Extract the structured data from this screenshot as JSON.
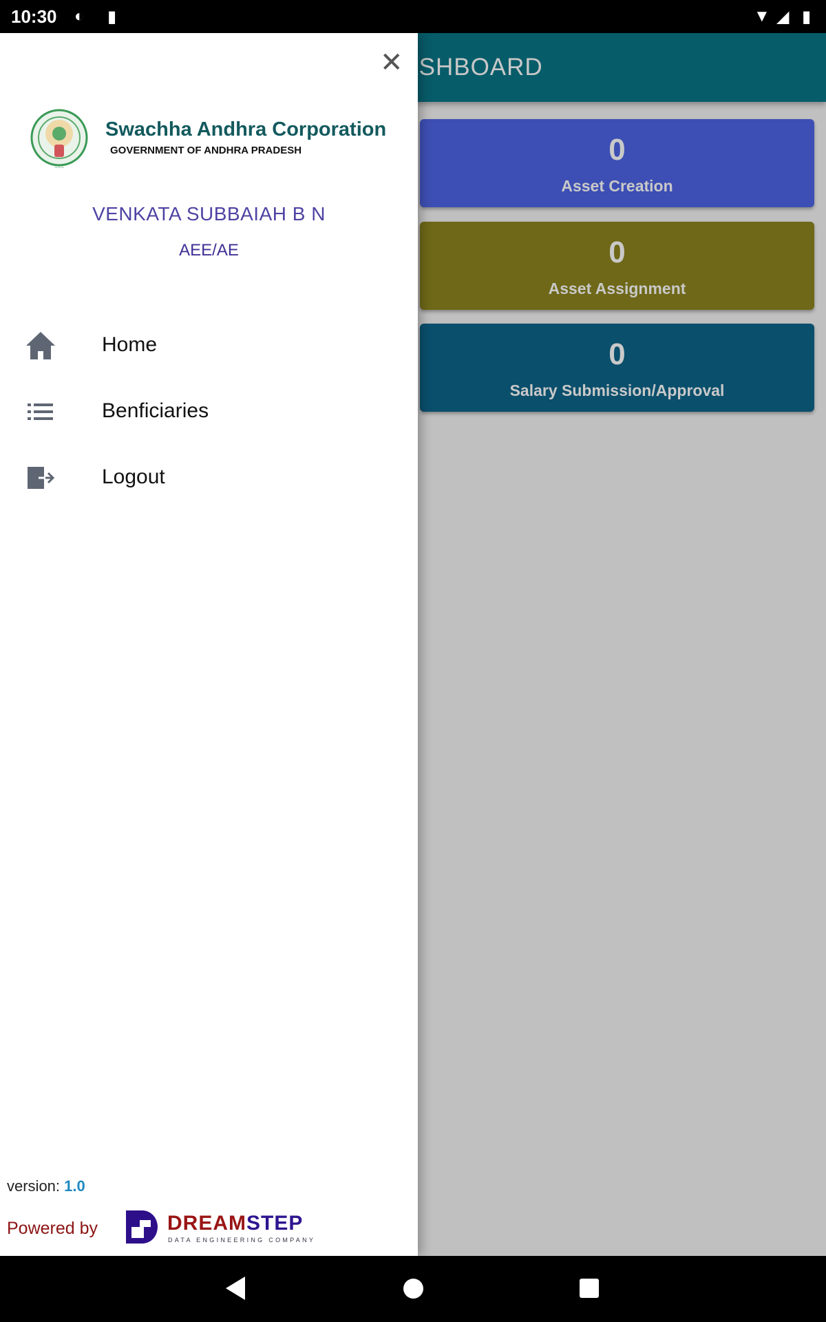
{
  "status_bar": {
    "time": "10:30"
  },
  "app_bar": {
    "title": "DASHBOARD"
  },
  "cards": [
    {
      "value": "0",
      "label": "Asset Creation",
      "color": "#3d4fb4"
    },
    {
      "value": "0",
      "label": "Asset Assignment",
      "color": "#6e6818"
    },
    {
      "value": "0",
      "label": "Salary Submission/Approval",
      "color": "#0a4f6c"
    }
  ],
  "drawer": {
    "brand_title": "Swachha Andhra Corporation",
    "brand_subtitle": "GOVERNMENT OF ANDHRA PRADESH",
    "user_name": "VENKATA SUBBAIAH B N",
    "user_role": "AEE/AE",
    "menu": [
      {
        "label": "Home",
        "icon": "home-icon"
      },
      {
        "label": "Benficiaries",
        "icon": "list-icon"
      },
      {
        "label": "Logout",
        "icon": "logout-icon"
      }
    ],
    "version_label": "version:",
    "version_value": "1.0",
    "powered_by": "Powered by",
    "company_name_a": "DREAM",
    "company_name_b": "STEP",
    "company_tagline": "DATA ENGINEERING COMPANY"
  }
}
